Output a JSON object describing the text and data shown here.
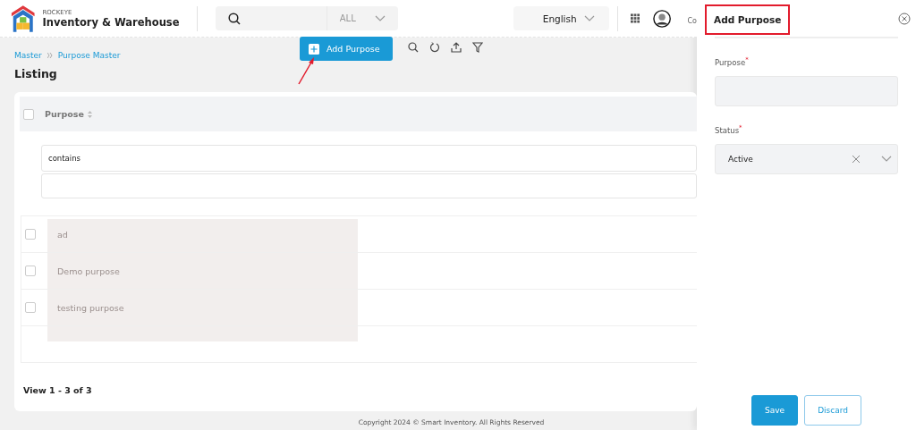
{
  "header": {
    "brand_small": "ROCKEYE",
    "brand": "Inventory & Warehouse",
    "search": {
      "scope": "ALL"
    },
    "language": "English",
    "user_name": "Co"
  },
  "breadcrumb": [
    {
      "label": "Master"
    },
    {
      "label": "Purpose Master"
    }
  ],
  "page_title": "Listing",
  "toolbar": {
    "add_button": "Add Purpose"
  },
  "table": {
    "header_checked": false,
    "columns": [
      {
        "label": "Purpose"
      }
    ],
    "filter": {
      "operator": "contains"
    },
    "rows": [
      {
        "purpose": "ad",
        "checked": false
      },
      {
        "purpose": "Demo purpose",
        "checked": false
      },
      {
        "purpose": "testing purpose",
        "checked": false
      }
    ],
    "pagination": "View 1 - 3 of 3"
  },
  "footer": "Copyright 2024 © Smart Inventory. All Rights Reserved",
  "panel": {
    "title": "Add Purpose",
    "fields": [
      {
        "kind": "text",
        "label": "Purpose$^{*}$"
      },
      {
        "kind": "select",
        "label": "Status$^{*}$",
        "value": "Active"
      }
    ],
    "buttons": [
      {
        "label": "Save",
        "kind": "primary"
      },
      {
        "label": "Discard",
        "kind": "secondary"
      }
    ]
  }
}
